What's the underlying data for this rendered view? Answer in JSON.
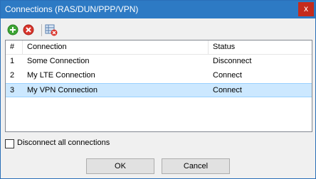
{
  "window": {
    "title": "Connections (RAS/DUN/PPP/VPN)",
    "close_glyph": "x"
  },
  "toolbar": {
    "add_icon": "add-icon",
    "remove_icon": "remove-icon",
    "disconnect_icon": "disconnect-table-icon"
  },
  "colors": {
    "titlebar": "#2d7ac4",
    "close": "#c42b1c",
    "selection": "#cce8ff",
    "add_green": "#3da535",
    "remove_red": "#d9342b"
  },
  "table": {
    "headers": [
      "#",
      "Connection",
      "Status"
    ],
    "rows": [
      {
        "num": "1",
        "connection": "Some Connection",
        "status": "Disconnect",
        "selected": false
      },
      {
        "num": "2",
        "connection": "My LTE Connection",
        "status": "Connect",
        "selected": false
      },
      {
        "num": "3",
        "connection": "My VPN Connection",
        "status": "Connect",
        "selected": true
      }
    ]
  },
  "options": {
    "disconnect_all_label": "Disconnect all connections",
    "disconnect_all_checked": false
  },
  "buttons": {
    "ok": "OK",
    "cancel": "Cancel"
  }
}
